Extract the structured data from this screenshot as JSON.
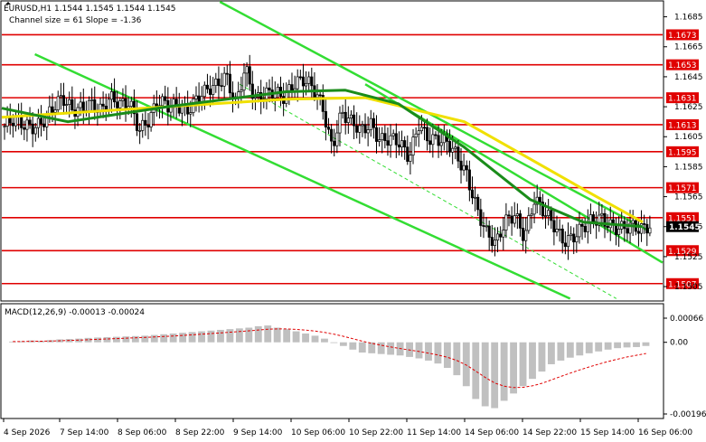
{
  "header": {
    "symbol_line": "EURUSD,H1  1.1544 1.1545 1.1544 1.1545",
    "channel_line": "Channel size = 61 Slope = -1.36"
  },
  "macd_label": "MACD(12,26,9) -0.00013 -0.00024",
  "chart_data": {
    "type": "candlestick",
    "symbol": "EURUSD",
    "timeframe": "H1",
    "ohlc_last": {
      "open": 1.1544,
      "high": 1.1545,
      "low": 1.1544,
      "close": 1.1545
    },
    "current_price": "1.1545",
    "ylim": [
      1.1496,
      1.1695
    ],
    "y_ticks": [
      "1.1685",
      "1.1665",
      "1.1645",
      "1.1625",
      "1.1605",
      "1.1585",
      "1.1565",
      "1.1545",
      "1.1525",
      "1.1505"
    ],
    "levels": [
      {
        "label": "1.1673",
        "value": 1.1673
      },
      {
        "label": "1.1653",
        "value": 1.1653
      },
      {
        "label": "1.1631",
        "value": 1.1631
      },
      {
        "label": "1.1613",
        "value": 1.1613
      },
      {
        "label": "1.1595",
        "value": 1.1595
      },
      {
        "label": "1.1571",
        "value": 1.1571
      },
      {
        "label": "1.1551",
        "value": 1.1551
      },
      {
        "label": "1.1529",
        "value": 1.1529
      },
      {
        "label": "1.1507",
        "value": 1.1507
      }
    ],
    "x_labels": [
      "4 Sep 2026",
      "7 Sep 14:00",
      "8 Sep 06:00",
      "8 Sep 22:00",
      "9 Sep 14:00",
      "10 Sep 06:00",
      "10 Sep 22:00",
      "11 Sep 14:00",
      "14 Sep 06:00",
      "14 Sep 22:00",
      "15 Sep 14:00",
      "16 Sep 06:00"
    ],
    "close_path": [
      1.1612,
      1.1614,
      1.1611,
      1.1613,
      1.1618,
      1.1624,
      1.1628,
      1.1621,
      1.1626,
      1.163,
      1.1622,
      1.1628,
      1.1625,
      1.163,
      1.1612,
      1.1616,
      1.1626,
      1.1624,
      1.1628,
      1.1625,
      1.163,
      1.1633,
      1.1638,
      1.1648,
      1.163,
      1.165,
      1.1626,
      1.1632,
      1.1638,
      1.1634,
      1.1639,
      1.164,
      1.1637,
      1.1628,
      1.16,
      1.162,
      1.1612,
      1.1608,
      1.1616,
      1.1605,
      1.1603,
      1.1598,
      1.159,
      1.1616,
      1.1606,
      1.1602,
      1.1598,
      1.1591,
      1.1582,
      1.156,
      1.154,
      1.153,
      1.1548,
      1.1556,
      1.154,
      1.1562,
      1.1552,
      1.1546,
      1.1538,
      1.154,
      1.1543,
      1.1546,
      1.155,
      1.1548,
      1.1546,
      1.1544,
      1.154,
      1.1545
    ],
    "ma_yellow": [
      [
        0,
        1.1618
      ],
      [
        0.25,
        1.1625
      ],
      [
        0.43,
        1.163
      ],
      [
        0.55,
        1.1631
      ],
      [
        0.7,
        1.1615
      ],
      [
        0.8,
        1.159
      ],
      [
        0.9,
        1.1565
      ],
      [
        0.97,
        1.1548
      ]
    ],
    "ma_green": [
      [
        0,
        1.1624
      ],
      [
        0.1,
        1.1615
      ],
      [
        0.25,
        1.1625
      ],
      [
        0.43,
        1.1635
      ],
      [
        0.52,
        1.1636
      ],
      [
        0.6,
        1.1627
      ],
      [
        0.7,
        1.1598
      ],
      [
        0.8,
        1.1563
      ],
      [
        0.88,
        1.1548
      ],
      [
        0.97,
        1.1545
      ]
    ],
    "channel": {
      "upper": [
        [
          0.33,
          1.1695
        ],
        [
          0.98,
          1.1542
        ]
      ],
      "lower": [
        [
          0.05,
          1.166
        ],
        [
          0.86,
          1.1497
        ]
      ],
      "mid": [
        [
          0.36,
          1.164
        ],
        [
          0.93,
          1.1497
        ]
      ],
      "right": [
        [
          0.55,
          1.164
        ],
        [
          1.0,
          1.1521
        ]
      ]
    },
    "macd": {
      "title": "MACD(12,26,9)",
      "main": -0.00013,
      "signal": -0.00024,
      "y_ticks": [
        "0.00066",
        "0.00",
        "-0.00196"
      ],
      "ylim": [
        -0.00196,
        0.00066
      ],
      "histogram": [
        2e-05,
        3e-05,
        5e-05,
        4e-05,
        6e-05,
        8e-05,
        9e-05,
        0.0001,
        0.00012,
        0.00013,
        0.00014,
        0.00015,
        0.00016,
        0.00017,
        0.00018,
        0.0002,
        0.00022,
        0.00024,
        0.00026,
        0.00028,
        0.0003,
        0.00032,
        0.00034,
        0.00036,
        0.00038,
        0.0004,
        0.00044,
        0.00046,
        0.0004,
        0.00036,
        0.0003,
        0.00024,
        0.00018,
        0.0001,
        0.0,
        -0.0001,
        -0.0002,
        -0.00028,
        -0.0003,
        -0.00032,
        -0.00034,
        -0.00036,
        -0.0004,
        -0.00044,
        -0.0005,
        -0.00058,
        -0.0007,
        -0.0009,
        -0.0012,
        -0.00155,
        -0.00175,
        -0.0018,
        -0.0016,
        -0.0014,
        -0.0012,
        -0.001,
        -0.0008,
        -0.0006,
        -0.0005,
        -0.00042,
        -0.00036,
        -0.0003,
        -0.00025,
        -0.0002,
        -0.00016,
        -0.00014,
        -0.00013,
        -0.0001
      ]
    }
  },
  "colors": {
    "level_line": "#e00000",
    "level_box": "#e00000",
    "ma_yellow": "#f0e000",
    "ma_green": "#1a8c1a",
    "channel": "#33dd33",
    "price_box": "#000000",
    "macd_hist": "#c0c0c0",
    "macd_signal": "#e00000"
  }
}
